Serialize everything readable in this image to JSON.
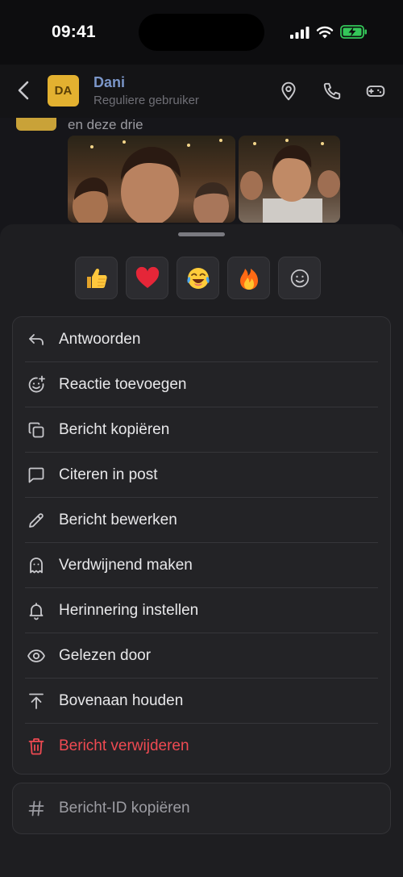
{
  "status_bar": {
    "time": "09:41",
    "icons": [
      "cellular-signal-icon",
      "wifi-icon",
      "battery-charging-icon"
    ]
  },
  "header": {
    "avatar_initials": "DA",
    "contact_name": "Dani",
    "contact_role": "Reguliere gebruiker",
    "actions": [
      "location-pin-icon",
      "phone-icon",
      "gamepad-icon"
    ]
  },
  "chat": {
    "message_text": "en deze drie"
  },
  "reactions": [
    {
      "name": "thumbs-up-reaction",
      "glyph": "👍"
    },
    {
      "name": "heart-reaction",
      "glyph": "❤"
    },
    {
      "name": "tears-of-joy-reaction",
      "glyph": "😂"
    },
    {
      "name": "fire-reaction",
      "glyph": "🔥"
    },
    {
      "name": "more-reactions",
      "glyph": "☺"
    }
  ],
  "menu": {
    "reply": "Antwoorden",
    "add_reaction": "Reactie toevoegen",
    "copy_message": "Bericht kopiëren",
    "quote_in_post": "Citeren in post",
    "edit_message": "Bericht bewerken",
    "make_disappearing": "Verdwijnend maken",
    "set_reminder": "Herinnering instellen",
    "read_by": "Gelezen door",
    "pin_to_top": "Bovenaan houden",
    "delete_message": "Bericht verwijderen"
  },
  "secondary": {
    "copy_id": "Bericht-ID kopiëren"
  },
  "colors": {
    "danger": "#ef4a52",
    "accent_name": "#7b96c9",
    "avatar": "#e3b130",
    "sheet": "#1e1e21"
  }
}
